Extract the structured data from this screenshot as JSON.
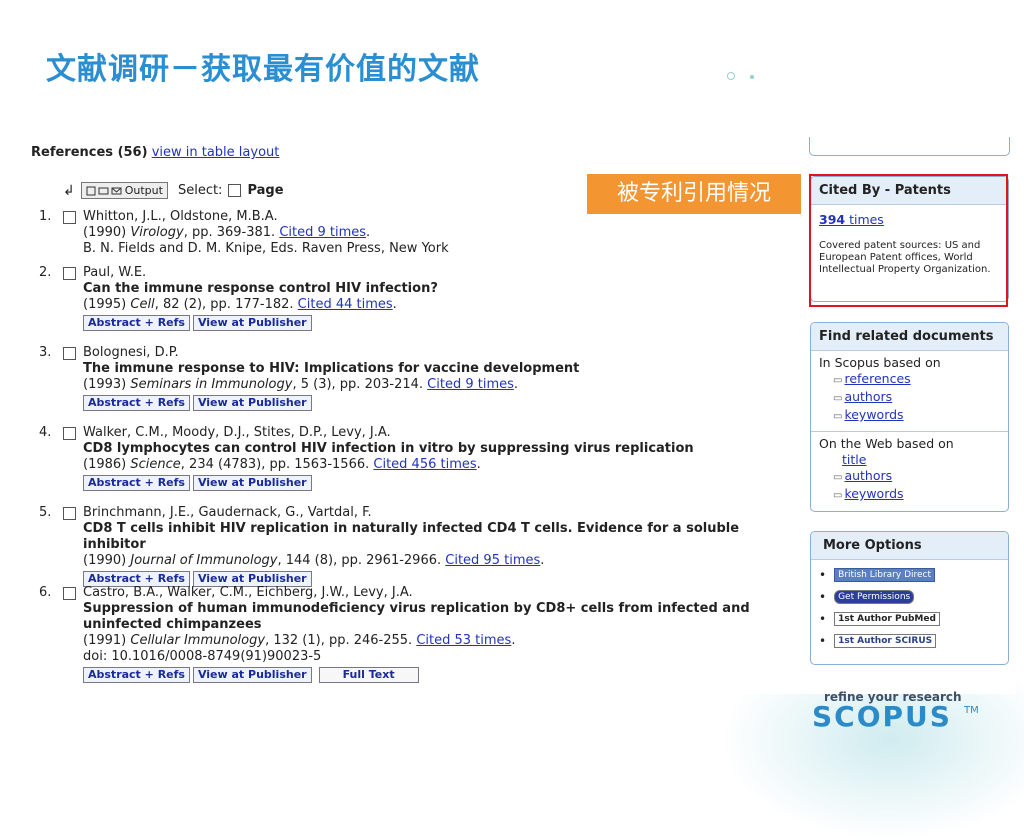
{
  "slide": {
    "title": "文献调研－获取最有价值的文献",
    "callout": "被专利引用情况"
  },
  "references": {
    "header_label": "References (56)",
    "table_link": "view in table layout",
    "output_label": "Output",
    "select_label": "Select:",
    "page_label": "Page",
    "items": [
      {
        "num": "1.",
        "authors": "Whitton, J.L., Oldstone, M.B.A.",
        "year": "(1990)",
        "journal": "Virology",
        "details": ", pp. 369-381.",
        "cited": "Cited 9 times",
        "extra": "B. N. Fields and D. M. Knipe, Eds. Raven Press, New York"
      },
      {
        "num": "2.",
        "authors": "Paul, W.E.",
        "title": "Can the immune response control HIV infection?",
        "year": "(1995)",
        "journal": "Cell",
        "details": ", 82 (2), pp. 177-182.",
        "cited": "Cited 44 times"
      },
      {
        "num": "3.",
        "authors": "Bolognesi, D.P.",
        "title": "The immune response to HIV: Implications for vaccine development",
        "year": "(1993)",
        "journal": "Seminars in Immunology",
        "details": ", 5 (3), pp. 203-214.",
        "cited": "Cited 9 times"
      },
      {
        "num": "4.",
        "authors": "Walker, C.M., Moody, D.J., Stites, D.P., Levy, J.A.",
        "title": "CD8 lymphocytes can control HIV infection in vitro by suppressing virus replication",
        "year": "(1986)",
        "journal": "Science",
        "details": ", 234 (4783), pp. 1563-1566.",
        "cited": "Cited 456 times"
      },
      {
        "num": "5.",
        "authors": "Brinchmann, J.E., Gaudernack, G., Vartdal, F.",
        "title": "CD8 T cells inhibit HIV replication in naturally infected CD4 T cells. Evidence for a soluble inhibitor",
        "year": "(1990)",
        "journal": "Journal of Immunology",
        "details": ", 144 (8), pp. 2961-2966.",
        "cited": "Cited 95 times"
      },
      {
        "num": "6.",
        "authors": "Castro, B.A., Walker, C.M., Eichberg, J.W., Levy, J.A.",
        "title": "Suppression of human immunodeficiency virus replication by CD8+ cells from infected and uninfected chimpanzees",
        "year": "(1991)",
        "journal": "Cellular Immunology",
        "details": ", 132 (1), pp. 246-255.",
        "cited": "Cited 53 times",
        "doi": "doi: 10.1016/0008-8749(91)90023-5"
      }
    ],
    "abstract_btn": "Abstract + Refs",
    "publisher_btn": "View at Publisher",
    "fulltext_btn": "Full Text"
  },
  "cited_by": {
    "title": "Cited By - Patents",
    "count": "394",
    "count_suffix": " times",
    "sources": "Covered patent sources: US and European Patent offices, World Intellectual Property Organization."
  },
  "related": {
    "title": "Find related documents",
    "scopus_heading": "In Scopus based on",
    "scopus_links": [
      "references",
      "authors",
      "keywords"
    ],
    "web_heading": "On the Web based on",
    "web_links": [
      "title",
      "authors",
      "keywords"
    ]
  },
  "more_options": {
    "title": "More Options",
    "items": [
      "British Library Direct",
      "Get Permissions",
      "1st Author PubMed",
      "1st Author SCIRUS"
    ]
  },
  "footer": {
    "tagline": "refine your research",
    "brand": "SCOPUS",
    "tm": "TM"
  },
  "colors": {
    "title_blue": "#2a8fd2",
    "callout_orange": "#f39530",
    "highlight_red": "#e1141b",
    "link_blue": "#2233bb"
  }
}
